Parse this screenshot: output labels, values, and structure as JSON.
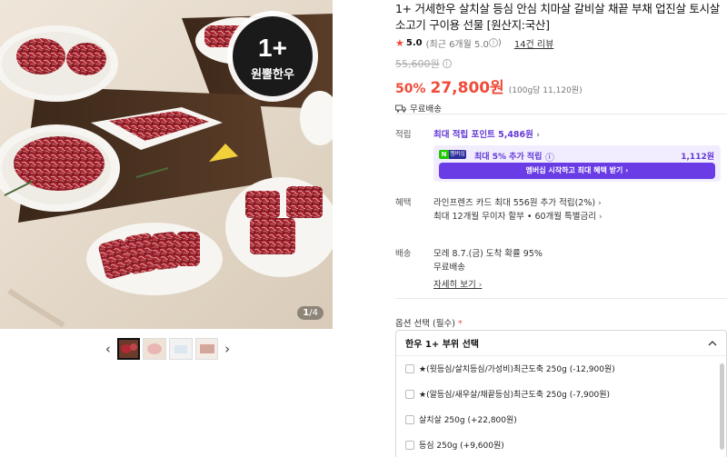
{
  "gallery": {
    "badge_top": "1+",
    "badge_bottom": "원뿔한우",
    "counter_current": "1",
    "counter_total": "/4",
    "prev_icon": "‹",
    "next_icon": "›"
  },
  "product": {
    "title": "1+ 거세한우 살치살 등심 안심 치마살 갈비살 채끝 부채 업진살 토시살 소고기 구이용 선물 [원산지:국산]",
    "rating": "5.0",
    "rating_sub": "(최근 6개월 5.0",
    "rating_sub_end": ")",
    "review_link": "14건 리뷰",
    "original_price": "55,600원",
    "discount": "50%",
    "sale_price": "27,800원",
    "unit_price": "(100g당 11,120원)",
    "shipping_badge": "무료배송"
  },
  "points": {
    "label": "적립",
    "max_points": "최대 적립 포인트 5,486원",
    "npay_badge_n": "N",
    "npay_badge_m": "멤버십",
    "npay_text": "최대 5% 추가 적립",
    "npay_amount": "1,112원",
    "npay_button": "멤버십 시작하고 최대 혜택 받기"
  },
  "benefit": {
    "label": "혜택",
    "line1": "라인프렌즈 카드 최대 556원 추가 적립(2%)",
    "line2": "최대 12개월 무이자 할부 • 60개월 특별금리"
  },
  "delivery": {
    "label": "배송",
    "line1": "모레 8.7.(금) 도착 확률 95%",
    "line2": "무료배송",
    "detail_link": "자세히 보기"
  },
  "options": {
    "label": "옵션 선택",
    "required_text": "(필수)",
    "required_mark": "*",
    "group_title": "한우 1+ 부위 선택",
    "items": [
      "★(윗등심/살치등심/가성비)최근도축 250g (-12,900원)",
      "★(알등심/새우살/채끝등심)최근도축 250g (-7,900원)",
      "살치살 250g (+22,800원)",
      "등심 250g (+9,600원)"
    ]
  },
  "colors": {
    "accent_red": "#f04b3a",
    "accent_purple": "#6338d6",
    "npay_green": "#1ec800"
  },
  "icons": [
    "star-icon",
    "info-icon",
    "truck-icon",
    "chevron-right-icon",
    "chevron-up-icon",
    "arrow-left-icon",
    "arrow-right-icon",
    "checkbox-icon"
  ]
}
